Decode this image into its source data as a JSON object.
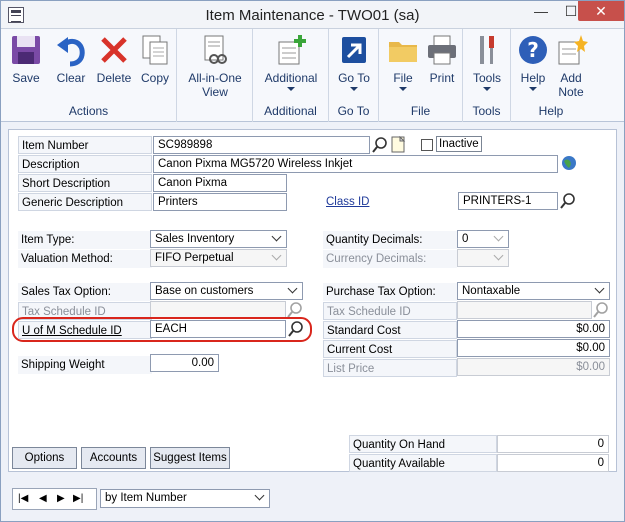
{
  "window": {
    "title": "Item Maintenance  -  TWO01 (sa)",
    "min_glyph": "—",
    "max_glyph": "☐",
    "close_glyph": "✕"
  },
  "ribbon": {
    "groups": [
      {
        "label": "Actions"
      },
      {
        "label": ""
      },
      {
        "label": "Additional"
      },
      {
        "label": "Go To"
      },
      {
        "label": "File"
      },
      {
        "label": "Tools"
      },
      {
        "label": "Help"
      }
    ],
    "buttons": {
      "save": "Save",
      "clear": "Clear",
      "delete": "Delete",
      "copy": "Copy",
      "all_in_one_1": "All-in-One",
      "all_in_one_2": "View",
      "additional": "Additional",
      "goto": "Go To",
      "file": "File",
      "print": "Print",
      "tools": "Tools",
      "help": "Help",
      "add_note_1": "Add",
      "add_note_2": "Note"
    }
  },
  "form": {
    "item_number": {
      "label": "Item Number",
      "value": "SC989898"
    },
    "inactive": {
      "label": "Inactive",
      "checked": false
    },
    "description": {
      "label": "Description",
      "value": "Canon Pixma MG5720 Wireless Inkjet"
    },
    "short_description": {
      "label": "Short Description",
      "value": "Canon Pixma"
    },
    "generic_description": {
      "label": "Generic Description",
      "value": "Printers"
    },
    "class_id": {
      "label": "Class ID",
      "value": "PRINTERS-1"
    },
    "item_type": {
      "label": "Item Type:",
      "value": "Sales Inventory"
    },
    "valuation_method": {
      "label": "Valuation Method:",
      "value": "FIFO Perpetual"
    },
    "quantity_decimals": {
      "label": "Quantity Decimals:",
      "value": "0"
    },
    "currency_decimals": {
      "label": "Currency Decimals:",
      "value": ""
    },
    "sales_tax_option": {
      "label": "Sales Tax Option:",
      "value": "Base on customers"
    },
    "sales_tax_schedule": {
      "label": "Tax Schedule ID",
      "value": ""
    },
    "uofm_schedule": {
      "label": "U of M Schedule ID",
      "value": "EACH"
    },
    "shipping_weight": {
      "label": "Shipping Weight",
      "value": "0.00"
    },
    "purchase_tax_option": {
      "label": "Purchase Tax Option:",
      "value": "Nontaxable"
    },
    "purchase_tax_schedule": {
      "label": "Tax Schedule ID",
      "value": ""
    },
    "standard_cost": {
      "label": "Standard Cost",
      "value": "$0.00"
    },
    "current_cost": {
      "label": "Current Cost",
      "value": "$0.00"
    },
    "list_price": {
      "label": "List Price",
      "value": "$0.00"
    }
  },
  "bottom": {
    "options": "Options",
    "accounts": "Accounts",
    "suggest_items": "Suggest Items",
    "qty_on_hand": {
      "label": "Quantity On Hand",
      "value": "0"
    },
    "qty_available": {
      "label": "Quantity Available",
      "value": "0"
    }
  },
  "navigation": {
    "first": "|◀",
    "prev": "◀",
    "next": "▶",
    "last": "▶|",
    "sort_by": "by Item Number"
  },
  "colors": {
    "highlight": "#d9261c",
    "link": "#1f3a9a",
    "ribbon_text": "#1f3a69"
  }
}
